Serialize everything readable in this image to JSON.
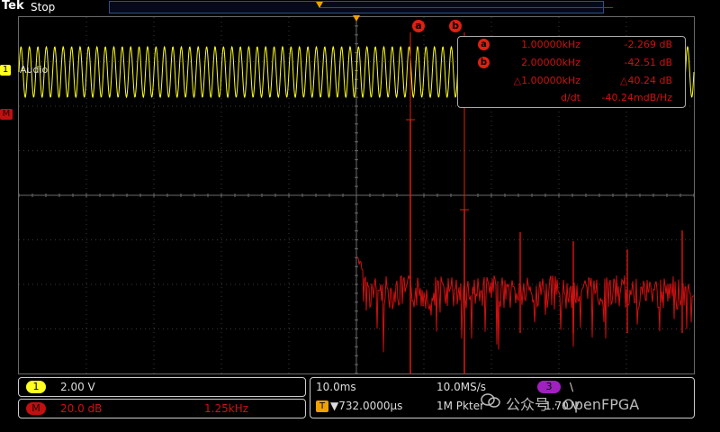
{
  "top": {
    "brand": "Tek",
    "state": "Stop"
  },
  "channels": {
    "ch1": {
      "number": "1",
      "name": "Audio",
      "color": "#ffff20"
    },
    "math": {
      "label": "M",
      "color": "#c01010"
    }
  },
  "cursors": {
    "a": {
      "label": "a"
    },
    "b": {
      "label": "b"
    }
  },
  "cursor_readout": {
    "rows": [
      {
        "badge": "a",
        "freq": "1.00000kHz",
        "amp": "-2.269 dB"
      },
      {
        "badge": "b",
        "freq": "2.00000kHz",
        "amp": "-42.51 dB"
      },
      {
        "badge": "",
        "freq": "△1.00000kHz",
        "amp": "△40.24 dB"
      },
      {
        "badge": "",
        "freq": "d/dt",
        "amp": "-40.24mdB/Hz"
      }
    ]
  },
  "status": {
    "ch1_num": "1",
    "ch1_scale": "2.00 V",
    "math_label": "M",
    "math_scale": "20.0 dB",
    "math_span": "1.25kHz",
    "timebase": "10.0ms",
    "sample_rate": "10.0MS/s",
    "trigger_pos": "▼732.0000μs",
    "record_length": "1M Pkter",
    "trig_channel": "3",
    "trig_slope": "\\",
    "trig_level": "1.70 V"
  },
  "watermark": {
    "text": "公众号 · OpenFPGA"
  },
  "colors": {
    "ch1": "#ffff20",
    "math": "#d01010",
    "cursor": "#e02010",
    "trigger": "#f0a000",
    "graticule": "#6a6a6a"
  },
  "spectrum": {
    "fundamental_freq": "1.00000kHz",
    "fundamental_db": -2.269,
    "harmonic2_freq": "2.00000kHz",
    "harmonic2_db": -42.51
  }
}
